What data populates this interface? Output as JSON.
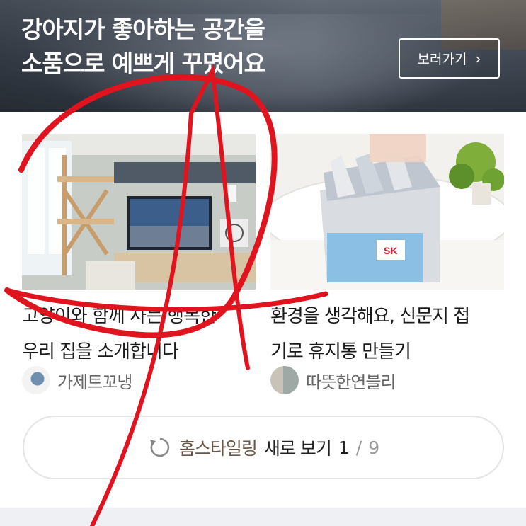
{
  "banner": {
    "title_line1": "강아지가 좋아하는 공간을",
    "title_line2": "소품으로 예쁘게 꾸몄어요",
    "button_label": "보러가기"
  },
  "cards": [
    {
      "title_line1": "고양이와 함께 사는 행복한",
      "title_line2": "우리 집을 소개합니다",
      "author": "가제트꼬냉"
    },
    {
      "title_line1": "환경을 생각해요, 신문지 접",
      "title_line2": "기로 휴지통 만들기",
      "author": "따뜻한연블리"
    }
  ],
  "refresh": {
    "accent_text": "홈스타일링",
    "text": "새로 보기",
    "page": "1",
    "separator": "/",
    "total": "9"
  },
  "colors": {
    "accent": "#6b5546",
    "marking": "#e0141e"
  },
  "icons": [
    "chevron-right-icon",
    "refresh-icon"
  ]
}
